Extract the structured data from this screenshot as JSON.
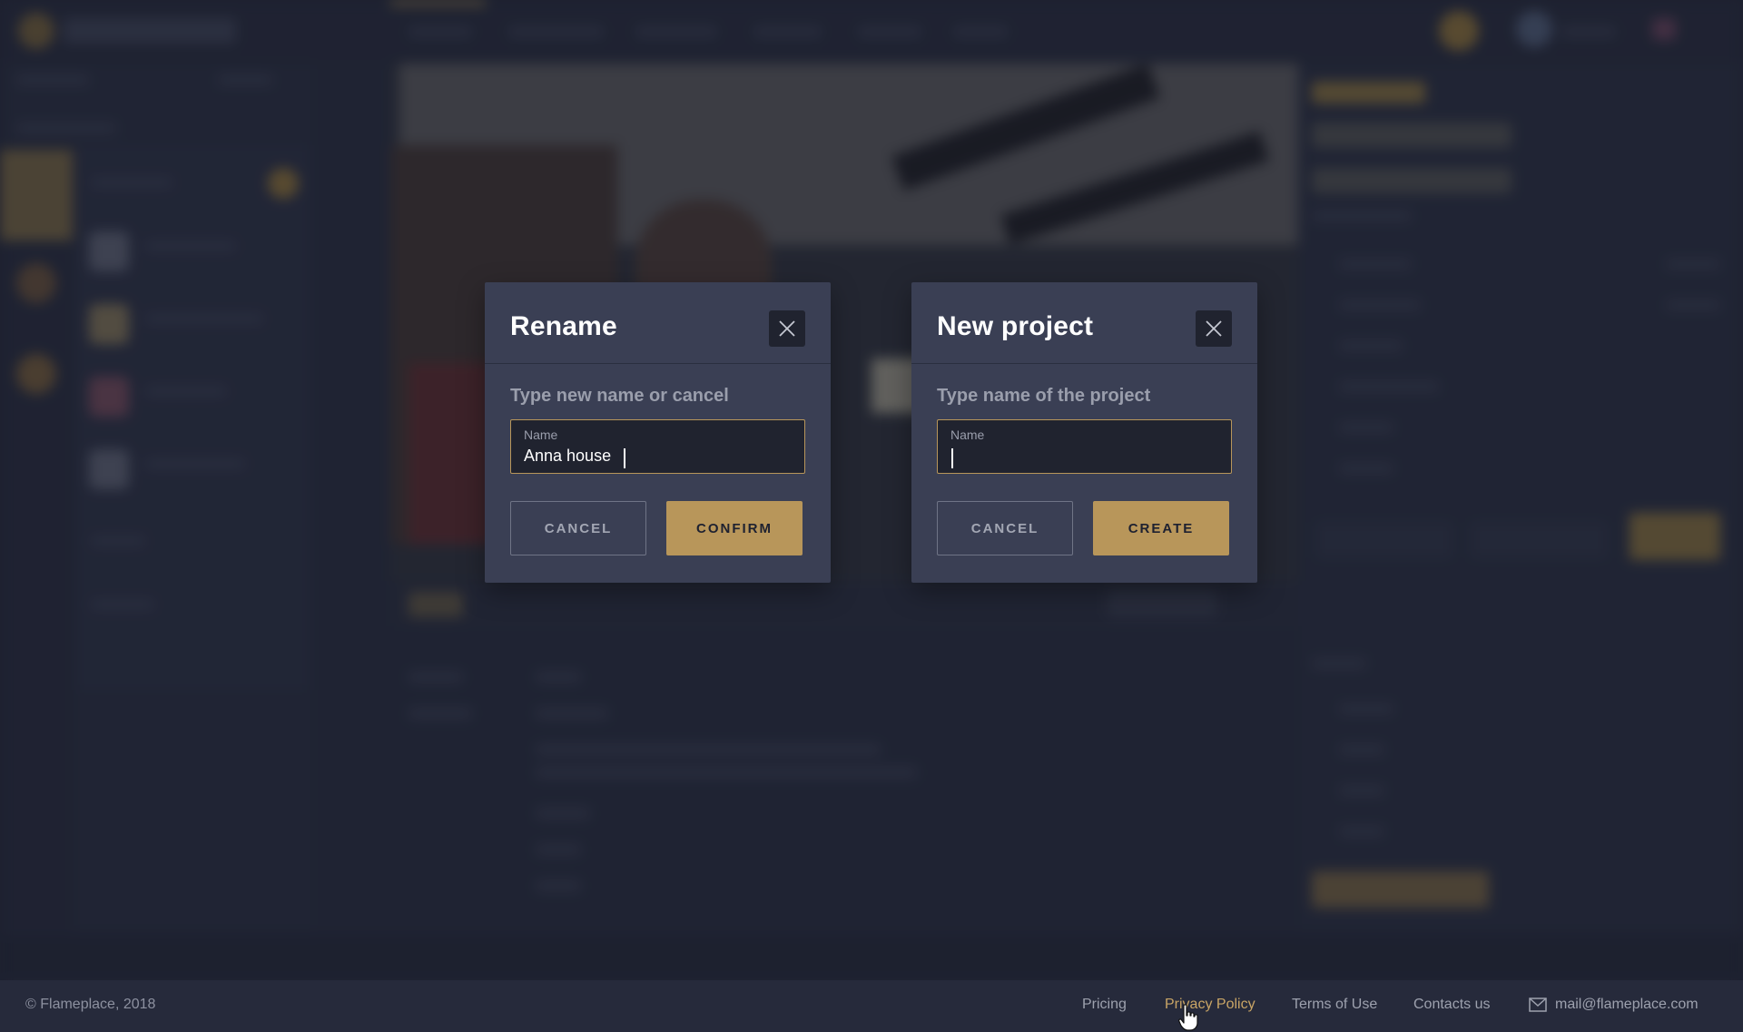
{
  "rename_dialog": {
    "title": "Rename",
    "prompt": "Type new name or cancel",
    "field_label": "Name",
    "field_value": "Anna house",
    "cancel_label": "CANCEL",
    "confirm_label": "CONFIRM",
    "close_icon": "close-icon"
  },
  "new_project_dialog": {
    "title": "New project",
    "prompt": "Type name of the project",
    "field_label": "Name",
    "field_value": "",
    "cancel_label": "CANCEL",
    "create_label": "CREATE",
    "close_icon": "close-icon"
  },
  "footer": {
    "copyright": "© Flameplace, 2018",
    "links": {
      "pricing": "Pricing",
      "privacy": "Privacy Policy",
      "terms": "Terms of Use",
      "contacts": "Contacts us"
    },
    "email": "mail@flameplace.com",
    "mail_icon": "mail-icon"
  },
  "colors": {
    "accent": "#b8965a",
    "dialog_bg": "#3a3f54",
    "field_bg": "#20232f",
    "link_active": "#c9a566"
  }
}
